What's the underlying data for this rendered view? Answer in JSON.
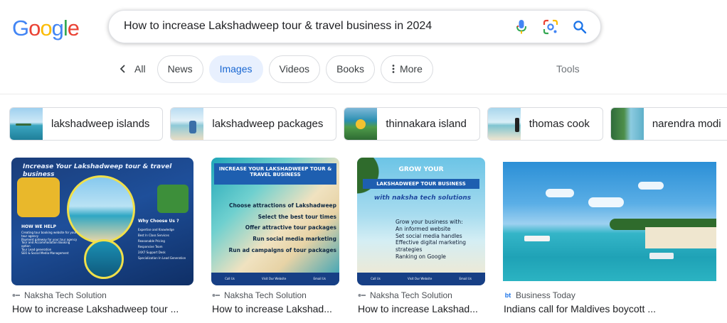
{
  "logo": {
    "letters": [
      "G",
      "o",
      "o",
      "g",
      "l",
      "e"
    ],
    "colors": [
      "#4285F4",
      "#EA4335",
      "#FBBC05",
      "#4285F4",
      "#34A853",
      "#EA4335"
    ]
  },
  "search": {
    "query": "How to increase Lakshadweep tour & travel business in 2024"
  },
  "tabs": {
    "back": "All",
    "items": [
      "News",
      "Images",
      "Videos",
      "Books",
      "More"
    ],
    "active": "Images",
    "tools": "Tools"
  },
  "chips": [
    {
      "label": "lakshadweep islands"
    },
    {
      "label": "lakshadweep packages"
    },
    {
      "label": "thinnakara island"
    },
    {
      "label": "thomas cook"
    },
    {
      "label": "narendra modi"
    }
  ],
  "results": [
    {
      "source": "Naksha Tech Solution",
      "title": "How to increase Lakshadweep tour ...",
      "image": {
        "headline": "Increase Your Lakshadweep tour & travel business",
        "how_heading": "HOW WE HELP",
        "how_items": [
          "Creating tour booking website for your tour agency",
          "Payment gateway for your tour agency",
          "Tour and Accommodation Booking option",
          "Tour Lead generation",
          "SEO & Social Media Management"
        ],
        "why_heading": "Why Choose Us ?",
        "why_items": [
          "Expertise and Knowledge",
          "Best In Class Services",
          "Reasonable Pricing",
          "Responsive Team",
          "24X7 Support Desk",
          "Specialization In Lead Generation"
        ]
      }
    },
    {
      "source": "Naksha Tech Solution",
      "title": "How to increase Lakshad...",
      "image": {
        "headline": "INCREASE YOUR LAKSHADWEEP TOUR & TRAVEL BUSINESS",
        "bullets": [
          "Choose attractions of Lakshadweep",
          "Select the best tour times",
          "Offer attractive tour packages",
          "Run social media marketing",
          "Run ad campaigns of tour packages"
        ],
        "footer": [
          "Call Us",
          "Visit Our Website",
          "Email Us"
        ]
      }
    },
    {
      "source": "Naksha Tech Solution",
      "title": "How to increase Lakshad...",
      "image": {
        "headline1": "GROW YOUR",
        "headline2": "LAKSHADWEEP TOUR BUSINESS",
        "script": "with naksha tech solutions",
        "intro": "Grow your business with:",
        "bullets": [
          "An informed website",
          "Set social media handles",
          "Effective digital marketing strategies",
          "Ranking on Google"
        ],
        "footer": [
          "Call Us",
          "Visit Our Website",
          "Email Us"
        ]
      }
    },
    {
      "source": "Business Today",
      "title": "Indians call for Maldives boycott ...",
      "favicon": "bt"
    }
  ],
  "colors": {
    "accent": "#1a73e8",
    "active_tab_bg": "#e8f0fe",
    "active_tab_text": "#1967d2"
  }
}
